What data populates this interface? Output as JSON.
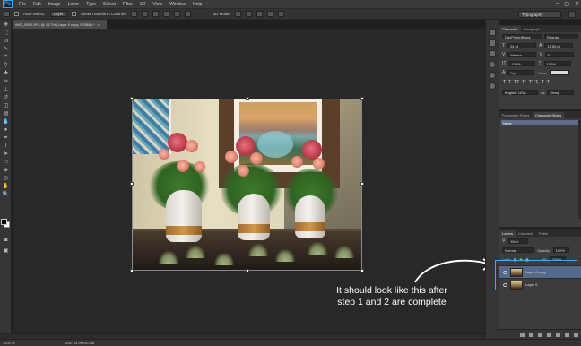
{
  "menubar": {
    "logo": "Ps",
    "items": [
      "File",
      "Edit",
      "Image",
      "Layer",
      "Type",
      "Select",
      "Filter",
      "3D",
      "View",
      "Window",
      "Help"
    ],
    "window_controls": [
      "–",
      "▢",
      "✕"
    ]
  },
  "options_bar": {
    "auto_select_label": "Auto-Select:",
    "auto_select_value": "Layer",
    "transform_controls_label": "Show Transform Controls",
    "mode_3d_label": "3D Mode:",
    "workspace": "Typography"
  },
  "document": {
    "tab_title": "IMG_0094.JPG @ 16.7% (Layer 0 copy, RGB/8) *",
    "close_glyph": "×"
  },
  "status_bar": {
    "zoom": "16.67%",
    "doc_info": "Doc: 34.9M/35.0M"
  },
  "character_panel": {
    "tabs": [
      "Character",
      "Paragraph"
    ],
    "font_family": "DayPrinterBlack",
    "font_style": "Regular",
    "font_size": "24 pt",
    "leading": "15.85 pt",
    "kerning": "Metrics",
    "tracking": "0",
    "vertical_scale": "100%",
    "horizontal_scale": "100%",
    "baseline_shift": "0 pt",
    "color_label": "Color:",
    "type_buttons": [
      "T",
      "T",
      "TT",
      "Tr",
      "T'",
      "T,",
      "T",
      "T"
    ],
    "language": "English: USA",
    "antialias_symbol": "aa",
    "antialias": "Sharp"
  },
  "styles_panel": {
    "tabs": [
      "Paragraph Styles",
      "Character Styles"
    ],
    "items": [
      "None"
    ]
  },
  "layers_panel": {
    "tabs": [
      "Layers",
      "Channels",
      "Paths"
    ],
    "kind": "Kind",
    "blend_mode": "Normal",
    "opacity_label": "Opacity:",
    "opacity": "100%",
    "lock_label": "Lock:",
    "fill_label": "Fill:",
    "fill": "100%",
    "layers": [
      {
        "name": "Layer 0 copy",
        "selected": true
      },
      {
        "name": "Layer 0",
        "selected": false
      }
    ]
  },
  "annotation": {
    "line1": "It should look like this after",
    "line2": "step 1 and 2 are complete"
  },
  "colors": {
    "highlight": "#2fb3e6",
    "selected_layer": "#546a8a",
    "accent_ps": "#31a8ff"
  }
}
